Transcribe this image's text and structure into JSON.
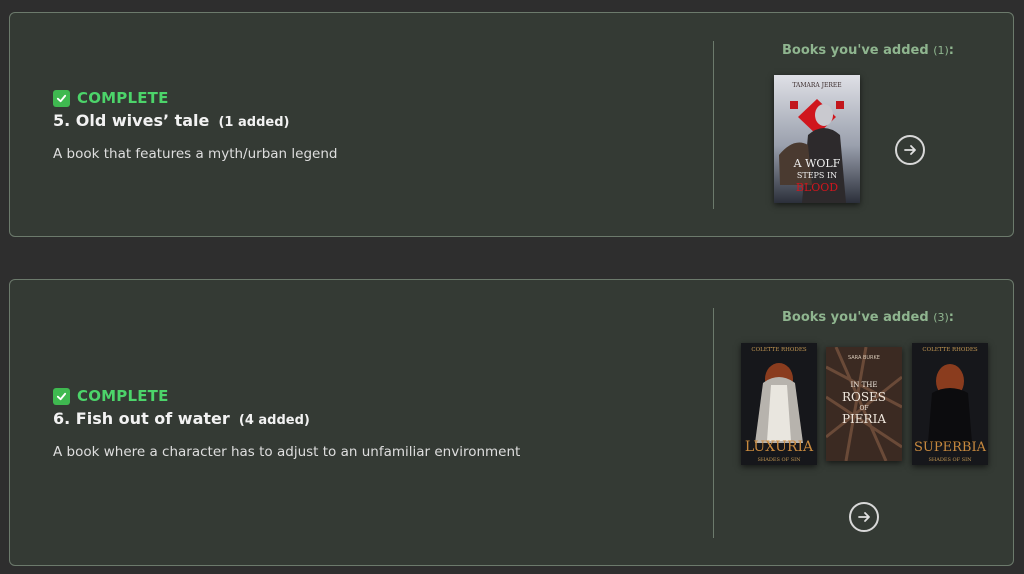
{
  "challenges": [
    {
      "status": "COMPLETE",
      "title": "5. Old wives’ tale",
      "count": "(1 added)",
      "description": "A book that features a myth/urban legend",
      "added_label": "Books you've added",
      "added_count": "(1)",
      "books": [
        {
          "author": "TAMARA JEREE",
          "title": "A WOLF STEPS IN BLOOD"
        }
      ]
    },
    {
      "status": "COMPLETE",
      "title": "6. Fish out of water",
      "count": "(4 added)",
      "description": "A book where a character has to adjust to an unfamiliar environment",
      "added_label": "Books you've added",
      "added_count": "(3)",
      "books": [
        {
          "author": "COLETTE RHODES",
          "title": "LUXURIA",
          "subtitle": "SHADES OF SIN"
        },
        {
          "author": "SARA BURKE",
          "title": "IN THE ROSES OF PIERIA"
        },
        {
          "author": "COLETTE RHODES",
          "title": "SUPERBIA",
          "subtitle": "SHADES OF SIN"
        }
      ]
    }
  ],
  "colors": {
    "accent": "#4cd46a",
    "card_bg": "#343a34",
    "page_bg": "#2e2e2e",
    "label": "#8fb58f"
  },
  "icons": {
    "status": "check-icon",
    "next": "arrow-right-circle-icon"
  }
}
